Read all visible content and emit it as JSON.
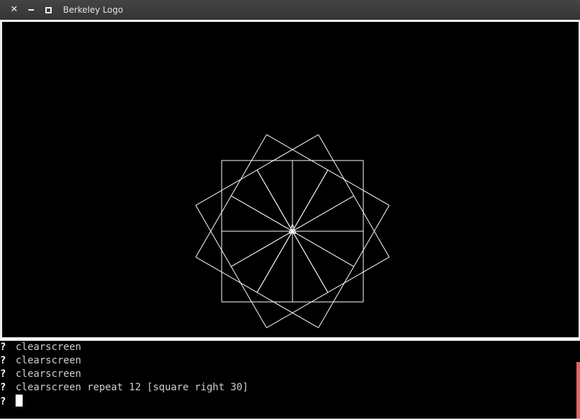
{
  "window": {
    "title": "Berkeley Logo",
    "controls": {
      "close_icon": "close-icon",
      "minimize_icon": "minimize-icon",
      "maximize_icon": "maximize-icon"
    }
  },
  "graphics": {
    "background_color": "#000000",
    "line_color": "#ffffff",
    "figure": {
      "repeat_count": 12,
      "turn_angle_degrees": 30,
      "shape": "square"
    },
    "turtle_icon": "turtle-triangle-icon"
  },
  "console": {
    "prompt": "?",
    "lines": [
      {
        "prompt": "?",
        "text": "clearscreen"
      },
      {
        "prompt": "?",
        "text": "clearscreen"
      },
      {
        "prompt": "?",
        "text": "clearscreen"
      },
      {
        "prompt": "?",
        "text": "clearscreen repeat 12 [square right 30]"
      }
    ],
    "input": {
      "prompt": "?",
      "value": ""
    },
    "scrollbar_color": "#e06666"
  }
}
